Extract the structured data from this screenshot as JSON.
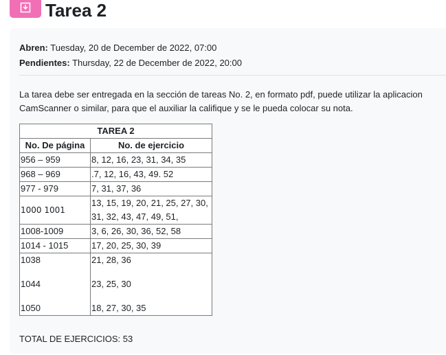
{
  "header": {
    "title": "Tarea 2",
    "icon": "assignment-icon",
    "icon_color": "#f06fb5"
  },
  "dates": {
    "open_label": "Abren:",
    "open_value": " Tuesday, 20 de December de 2022, 07:00",
    "due_label": "Pendientes:",
    "due_value": " Thursday, 22 de December de 2022, 20:00"
  },
  "description": "La tarea debe ser entregada en la sección de tareas No. 2, en formato pdf, puede utilizar la aplicacion CamScanner o similar,  para que el auxiliar la califique y se le pueda colocar su nota.",
  "table": {
    "caption": "TAREA 2",
    "headers": [
      "No. De página",
      "No. de ejercicio"
    ],
    "rows": [
      [
        "956 – 959",
        "8, 12, 16, 23, 31, 34, 35"
      ],
      [
        "968 – 969",
        ".7, 12, 16, 43, 49. 52"
      ],
      [
        "977 - 979",
        "7, 31, 37, 36"
      ],
      [
        "1000 1001",
        "13, 15, 19, 20, 21, 25, 27, 30,",
        "31, 32, 43, 47, 49, 51,"
      ],
      [
        "1008-1009",
        " 3, 6, 26, 30, 36, 52, 58"
      ],
      [
        "1014 - 1015",
        "17, 20, 25, 30, 39"
      ],
      [
        "1038",
        "21, 28, 36"
      ],
      [
        "1044",
        "23, 25, 30"
      ],
      [
        "1050",
        "18,  27, 30, 35"
      ]
    ]
  },
  "total": "TOTAL DE EJERCICIOS: 53"
}
